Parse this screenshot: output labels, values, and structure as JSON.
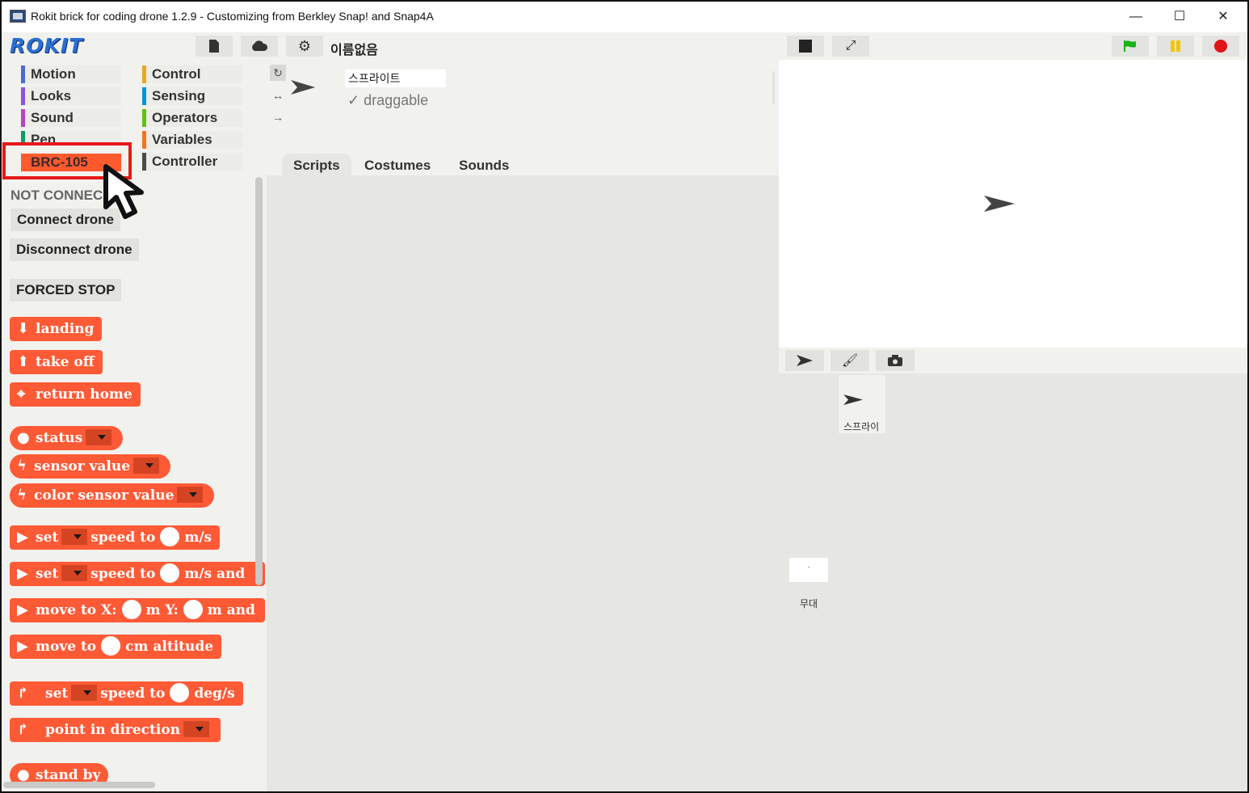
{
  "window": {
    "title": "Rokit brick for coding drone 1.2.9 - Customizing from Berkley Snap! and Snap4A",
    "minimize": "—",
    "maximize": "☐",
    "close": "✕"
  },
  "toolbar": {
    "logo": "ROKIT",
    "project_name": "이름없음",
    "file_icon": "file-icon",
    "cloud_icon": "cloud-icon",
    "settings_icon": "gear-icon"
  },
  "categories": [
    {
      "label": "Motion",
      "color": "#4a6cd4"
    },
    {
      "label": "Looks",
      "color": "#8a55d7"
    },
    {
      "label": "Sound",
      "color": "#bb42c3"
    },
    {
      "label": "Pen",
      "color": "#0e9a6c"
    },
    {
      "label": "BRC-105",
      "color": "#ff5a2e"
    },
    {
      "label": "Control",
      "color": "#e6a822"
    },
    {
      "label": "Sensing",
      "color": "#0494dc"
    },
    {
      "label": "Operators",
      "color": "#62c213"
    },
    {
      "label": "Variables",
      "color": "#f3761d"
    },
    {
      "label": "Controller",
      "color": "#4a4a4a"
    }
  ],
  "palette": {
    "status_text": "NOT CONNEC",
    "connect": "Connect drone",
    "disconnect": "Disconnect drone",
    "forced_stop": "FORCED STOP",
    "blocks": {
      "landing": "landing",
      "take_off": "take off",
      "return_home": "return home",
      "status": "status",
      "sensor_value": "sensor value",
      "color_sensor_value": "color sensor value",
      "set1_a": "set",
      "set1_b": "speed to",
      "set1_c": "m/s",
      "set2_a": "set",
      "set2_b": "speed to",
      "set2_c": "m/s and",
      "move_a": "move to X:",
      "move_b": "m Y:",
      "move_c": "m and",
      "alt_a": "move to",
      "alt_b": "cm altitude",
      "rot_a": "set",
      "rot_b": "speed to",
      "rot_c": "deg/s",
      "point": "point in direction",
      "standby": "stand by"
    }
  },
  "sprite": {
    "name": "스프라이트",
    "draggable_check": "✓",
    "draggable": "draggable",
    "tabs": [
      "Scripts",
      "Costumes",
      "Sounds"
    ]
  },
  "corral": {
    "sprite_label": "스프라이",
    "stage_thumb": "·",
    "stage_label": "무대"
  },
  "colors": {
    "block": "#ff5a36",
    "highlight": "#e81818",
    "green_flag": "#17b317",
    "pause": "#f2c40f",
    "stop": "#e01515"
  }
}
